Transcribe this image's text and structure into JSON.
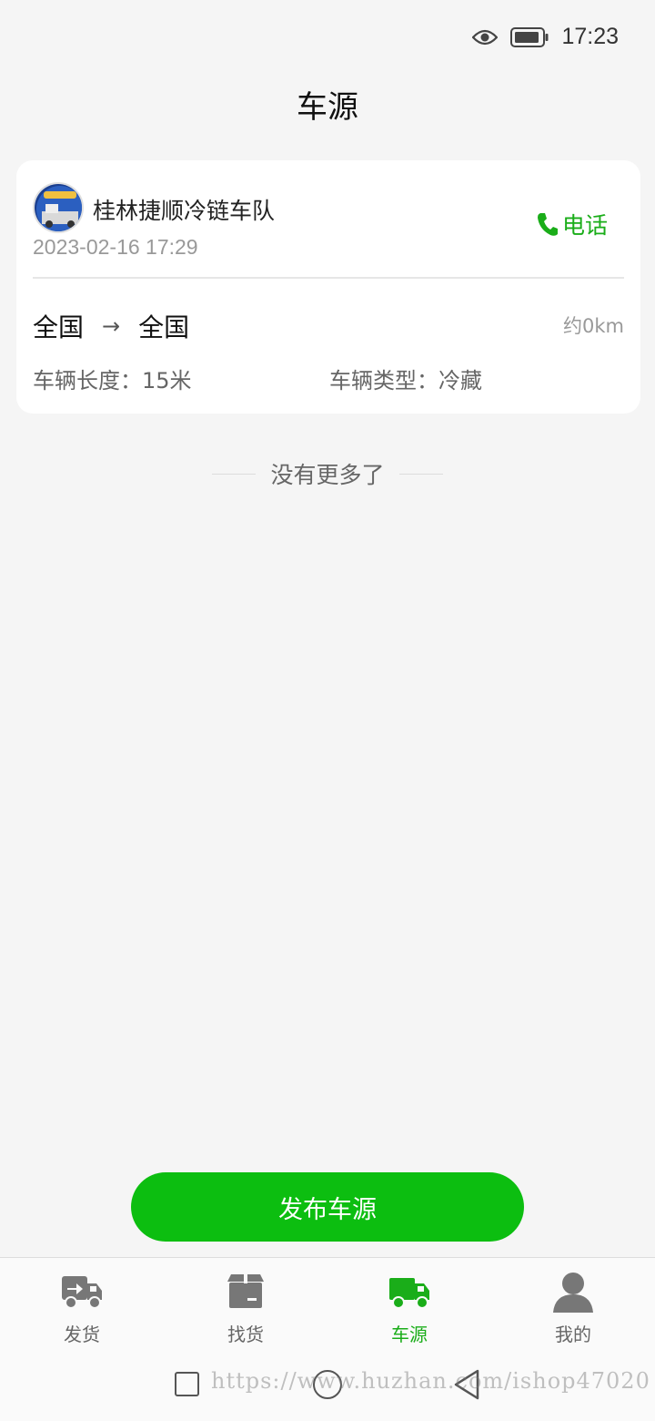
{
  "status_bar": {
    "time": "17:23",
    "icons": [
      "eye-icon",
      "battery-icon"
    ]
  },
  "header": {
    "title": "车源"
  },
  "listing": {
    "company": "桂林捷顺冷链车队",
    "date": "2023-02-16 17:29",
    "call_label": "电话",
    "origin": "全国",
    "arrow": "→",
    "destination": "全国",
    "distance": "约0km",
    "vehicle_length": "车辆长度：15米",
    "vehicle_type": "车辆类型：冷藏"
  },
  "list_end": "没有更多了",
  "publish_button": "发布车源",
  "tabs": [
    {
      "label": "发货",
      "icon": "truck-arrow-icon",
      "active": false
    },
    {
      "label": "找货",
      "icon": "box-icon",
      "active": false
    },
    {
      "label": "车源",
      "icon": "truck-icon",
      "active": true
    },
    {
      "label": "我的",
      "icon": "user-icon",
      "active": false
    }
  ],
  "watermark": "https://www.huzhan.com/ishop47020",
  "colors": {
    "accent": "#1aad19",
    "button": "#0cbe10",
    "background": "#f5f5f5"
  }
}
